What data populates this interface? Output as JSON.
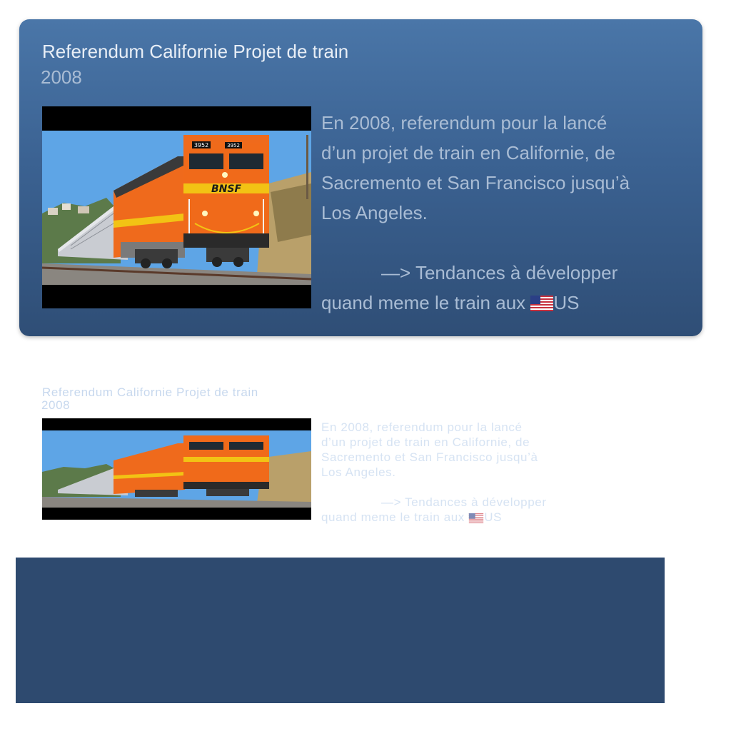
{
  "card": {
    "title": "Referendum Californie Projet de train",
    "year": "2008",
    "image": {
      "icon": "train-locomotive-photo",
      "locomotive_number": "3952",
      "logo_text": "BNSF"
    },
    "paragraph_lines": [
      "En 2008, referendum pour la lancé",
      "d’un projet de train en Californie, de",
      "Sacremento et San Francisco jusqu’à",
      "Los Angeles."
    ],
    "arrow_line": "—> Tendances à développer",
    "last_line_prefix": "quand meme le train aux ",
    "flag_icon": "us-flag-icon",
    "last_line_suffix": "US"
  },
  "colors": {
    "card_top": "#4a76a8",
    "card_bottom": "#2f4e76",
    "title": "#e8eef6",
    "muted_text": "#a9bcd4",
    "ghost_text": "#c7d8ee",
    "bottom_block": "#2e4a6f"
  }
}
